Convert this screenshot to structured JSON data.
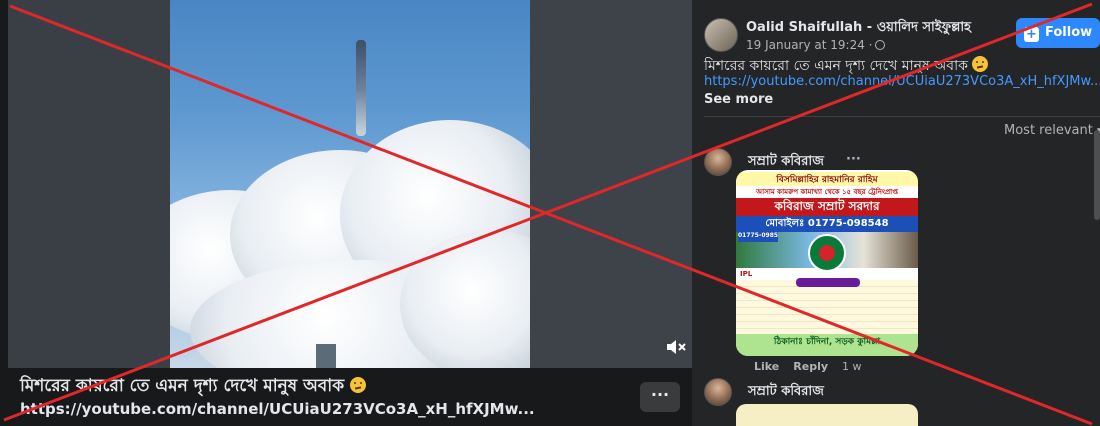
{
  "video": {
    "mute_icon": "speaker-mute-icon"
  },
  "caption": {
    "title": "মিশরের কায়রো তে এমন দৃশ্য দেখে মানুষ অবাক",
    "link": "https://youtube.com/channel/UCUiaU273VCo3A_xH_hfXJMw...",
    "more_label": "···"
  },
  "post": {
    "author": "Oalid Shaifullah - ওয়ালিদ সাইফুল্লাহ",
    "time": "19 January at 19:24 ·",
    "follow_label": "Follow",
    "text": "মিশরের কায়রো তে এমন দৃশ্য দেখে মানুষ অবাক",
    "link": "https://youtube.com/channel/UCUiaU273VCo3A_xH_hfXJMw...",
    "see_more": "See more"
  },
  "comments": {
    "sort_label": "Most relevant",
    "items": [
      {
        "name": "সম্রাট কবিরাজ",
        "dots": "···",
        "poster": {
          "line1": "বিসমিল্লাহির রাহমানির রাহিম",
          "line2": "আসাম কামরুপ কামাখ্যা থেকে ১৫ বছর ট্রেনিংপ্রাপ্ত",
          "line3": "কবিরাজ সম্রাট সরদার",
          "line4": "মোবাইলঃ 01775-098548",
          "line5": "01775-098548",
          "line6": "IPL",
          "line7": "ঠিকানাঃ চাঁদিনা, সড়ক কুমিল্লা"
        },
        "like": "Like",
        "reply": "Reply",
        "age": "1 w"
      },
      {
        "name": "সম্রাট কবিরাজ"
      }
    ]
  },
  "colors": {
    "accent": "#2d88ff",
    "link": "#4599ff",
    "cross": "#e0272a"
  }
}
